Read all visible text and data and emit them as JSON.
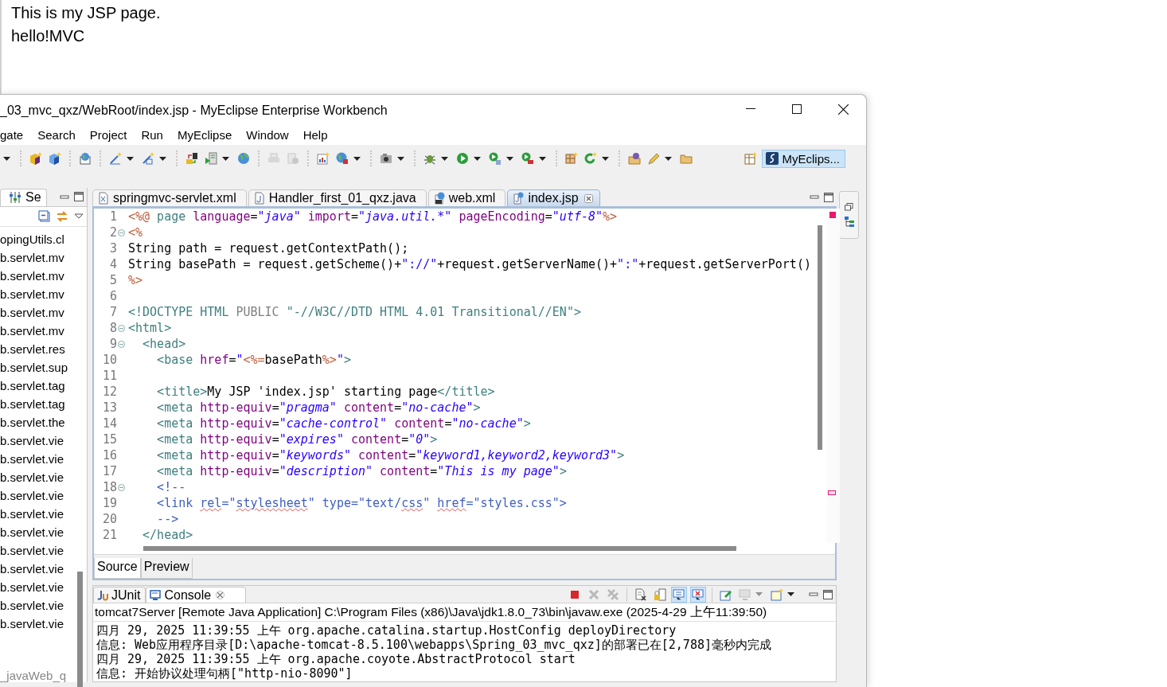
{
  "browser_page": {
    "lines": [
      "This is my JSP page.",
      "hello!MVC"
    ]
  },
  "window": {
    "title": "_03_mvc_qxz/WebRoot/index.jsp - MyEclipse Enterprise Workbench"
  },
  "menu": [
    "gate",
    "Search",
    "Project",
    "Run",
    "MyEclipse",
    "Window",
    "Help"
  ],
  "toolbar": {
    "groups": [
      [
        {
          "kind": "none",
          "dropdown": true,
          "disabled": false
        }
      ],
      [
        {
          "kind": "cube",
          "dropdown": false,
          "disabled": false
        },
        {
          "kind": "cube-blue",
          "dropdown": false,
          "disabled": false
        }
      ],
      [
        {
          "kind": "web-page",
          "dropdown": false,
          "disabled": false
        }
      ],
      [
        {
          "kind": "wand",
          "dropdown": true,
          "disabled": false
        },
        {
          "kind": "wand2",
          "dropdown": true,
          "disabled": false
        }
      ],
      [
        {
          "kind": "server",
          "dropdown": false,
          "disabled": false
        },
        {
          "kind": "server-run",
          "dropdown": true,
          "disabled": false
        },
        {
          "kind": "globe",
          "dropdown": false,
          "disabled": false
        }
      ],
      [
        {
          "kind": "printer",
          "dropdown": false,
          "disabled": true
        },
        {
          "kind": "disk",
          "dropdown": false,
          "disabled": true
        }
      ],
      [
        {
          "kind": "chart",
          "dropdown": false,
          "disabled": false
        },
        {
          "kind": "globe-lock",
          "dropdown": true,
          "disabled": false
        }
      ],
      [
        {
          "kind": "camera",
          "dropdown": true,
          "disabled": false
        }
      ],
      [
        {
          "kind": "bug",
          "dropdown": true,
          "disabled": false
        },
        {
          "kind": "play",
          "dropdown": true,
          "disabled": false
        },
        {
          "kind": "run-list",
          "dropdown": true,
          "disabled": false
        },
        {
          "kind": "run-tool",
          "dropdown": true,
          "disabled": false
        }
      ],
      [
        {
          "kind": "grid",
          "dropdown": false,
          "disabled": false
        },
        {
          "kind": "refresh",
          "dropdown": true,
          "disabled": false
        }
      ],
      [
        {
          "kind": "folder-globe",
          "dropdown": false,
          "disabled": false
        },
        {
          "kind": "pen",
          "dropdown": true,
          "disabled": false
        },
        {
          "kind": "folder",
          "dropdown": false,
          "disabled": false
        }
      ]
    ],
    "perspective": {
      "label": "MyEclips...",
      "selected": true
    }
  },
  "explorer": {
    "tab": "Se",
    "items": [
      "opingUtils.cl",
      "b.servlet.mv",
      "b.servlet.mv",
      "b.servlet.mv",
      "b.servlet.mv",
      "b.servlet.mv",
      "b.servlet.res",
      "b.servlet.sup",
      "b.servlet.tag",
      "b.servlet.tag",
      "b.servlet.the",
      "b.servlet.vie",
      "b.servlet.vie",
      "b.servlet.vie",
      "b.servlet.vie",
      "b.servlet.vie",
      "b.servlet.vie",
      "b.servlet.vie",
      "b.servlet.vie",
      "b.servlet.vie",
      "b.servlet.vie",
      "b.servlet.vie"
    ],
    "footer": "_javaWeb_q"
  },
  "editor": {
    "tabs": [
      {
        "label": "springmvc-servlet.xml",
        "selected": false
      },
      {
        "label": "Handler_first_01_qxz.java",
        "selected": false
      },
      {
        "label": "web.xml",
        "selected": false
      },
      {
        "label": "index.jsp",
        "selected": true
      }
    ],
    "lines": [
      {
        "number": "1",
        "fold": false,
        "tokens": [
          {
            "t": "<%@",
            "kind": "jsp"
          },
          {
            "t": " page",
            "kind": "tag"
          },
          {
            "t": " language",
            "kind": "attr"
          },
          {
            "t": "=",
            "kind": "text"
          },
          {
            "t": "\"java\"",
            "kind": "value"
          },
          {
            "t": " import",
            "kind": "attr"
          },
          {
            "t": "=",
            "kind": "text"
          },
          {
            "t": "\"java.util.*\"",
            "kind": "value"
          },
          {
            "t": " pageEncoding",
            "kind": "attr"
          },
          {
            "t": "=",
            "kind": "text"
          },
          {
            "t": "\"utf-8\"",
            "kind": "value"
          },
          {
            "t": "%>",
            "kind": "jsp"
          }
        ]
      },
      {
        "number": "2",
        "fold": true,
        "tokens": [
          {
            "t": "<%",
            "kind": "jsp"
          }
        ]
      },
      {
        "number": "3",
        "fold": false,
        "tokens": [
          {
            "t": "String path = request.getContextPath();",
            "kind": "text"
          }
        ]
      },
      {
        "number": "4",
        "fold": false,
        "tokens": [
          {
            "t": "String basePath = request.getScheme()+",
            "kind": "text"
          },
          {
            "t": "\"://\"",
            "kind": "str"
          },
          {
            "t": "+request.getServerName()+",
            "kind": "text"
          },
          {
            "t": "\":\"",
            "kind": "str"
          },
          {
            "t": "+request.getServerPort()",
            "kind": "text"
          }
        ]
      },
      {
        "number": "5",
        "fold": false,
        "tokens": [
          {
            "t": "%>",
            "kind": "jsp"
          }
        ]
      },
      {
        "number": "6",
        "fold": false
      },
      {
        "number": "7",
        "fold": false,
        "tokens": [
          {
            "t": "<!DOCTYPE HTML ",
            "kind": "tag"
          },
          {
            "t": "PUBLIC ",
            "kind": "grey"
          },
          {
            "t": "\"-//W3C//DTD HTML 4.01 Transitional//EN\">",
            "kind": "tag"
          }
        ]
      },
      {
        "number": "8",
        "fold": true,
        "tokens": [
          {
            "t": "<html>",
            "kind": "tag"
          }
        ]
      },
      {
        "number": "9",
        "fold": true,
        "tokens": [
          {
            "t": "  <head>",
            "kind": "tag"
          }
        ]
      },
      {
        "number": "10",
        "fold": false,
        "tokens": [
          {
            "t": "    <base",
            "kind": "tag"
          },
          {
            "t": " href",
            "kind": "attr"
          },
          {
            "t": "=",
            "kind": "text"
          },
          {
            "t": "\"",
            "kind": "str"
          },
          {
            "t": "<%=",
            "kind": "jsp"
          },
          {
            "t": "basePath",
            "kind": "text"
          },
          {
            "t": "%>",
            "kind": "jsp"
          },
          {
            "t": "\"",
            "kind": "str"
          },
          {
            "t": ">",
            "kind": "tag"
          }
        ]
      },
      {
        "number": "11",
        "fold": false
      },
      {
        "number": "12",
        "fold": false,
        "tokens": [
          {
            "t": "    <title>",
            "kind": "tag"
          },
          {
            "t": "My JSP 'index.jsp' starting page",
            "kind": "text"
          },
          {
            "t": "</title>",
            "kind": "tag"
          }
        ]
      },
      {
        "number": "13",
        "fold": false,
        "tokens": [
          {
            "t": "    <meta",
            "kind": "tag"
          },
          {
            "t": " http-equiv",
            "kind": "attr"
          },
          {
            "t": "=",
            "kind": "text"
          },
          {
            "t": "\"pragma\"",
            "kind": "value"
          },
          {
            "t": " content",
            "kind": "attr"
          },
          {
            "t": "=",
            "kind": "text"
          },
          {
            "t": "\"no-cache\"",
            "kind": "value"
          },
          {
            "t": ">",
            "kind": "tag"
          }
        ]
      },
      {
        "number": "14",
        "fold": false,
        "tokens": [
          {
            "t": "    <meta",
            "kind": "tag"
          },
          {
            "t": " http-equiv",
            "kind": "attr"
          },
          {
            "t": "=",
            "kind": "text"
          },
          {
            "t": "\"cache-control\"",
            "kind": "value"
          },
          {
            "t": " content",
            "kind": "attr"
          },
          {
            "t": "=",
            "kind": "text"
          },
          {
            "t": "\"no-cache\"",
            "kind": "value"
          },
          {
            "t": ">",
            "kind": "tag"
          }
        ]
      },
      {
        "number": "15",
        "fold": false,
        "tokens": [
          {
            "t": "    <meta",
            "kind": "tag"
          },
          {
            "t": " http-equiv",
            "kind": "attr"
          },
          {
            "t": "=",
            "kind": "text"
          },
          {
            "t": "\"expires\"",
            "kind": "value"
          },
          {
            "t": " content",
            "kind": "attr"
          },
          {
            "t": "=",
            "kind": "text"
          },
          {
            "t": "\"0\"",
            "kind": "value"
          },
          {
            "t": ">",
            "kind": "tag"
          }
        ]
      },
      {
        "number": "16",
        "fold": false,
        "tokens": [
          {
            "t": "    <meta",
            "kind": "tag"
          },
          {
            "t": " http-equiv",
            "kind": "attr"
          },
          {
            "t": "=",
            "kind": "text"
          },
          {
            "t": "\"keywords\"",
            "kind": "value"
          },
          {
            "t": " content",
            "kind": "attr"
          },
          {
            "t": "=",
            "kind": "text"
          },
          {
            "t": "\"keyword1,keyword2,keyword3\"",
            "kind": "value"
          },
          {
            "t": ">",
            "kind": "tag"
          }
        ]
      },
      {
        "number": "17",
        "fold": false,
        "tokens": [
          {
            "t": "    <meta",
            "kind": "tag"
          },
          {
            "t": " http-equiv",
            "kind": "attr"
          },
          {
            "t": "=",
            "kind": "text"
          },
          {
            "t": "\"description\"",
            "kind": "value"
          },
          {
            "t": " content",
            "kind": "attr"
          },
          {
            "t": "=",
            "kind": "text"
          },
          {
            "t": "\"This is my page\"",
            "kind": "value"
          },
          {
            "t": ">",
            "kind": "tag"
          }
        ]
      },
      {
        "number": "18",
        "fold": true,
        "tokens": [
          {
            "t": "    <!--",
            "kind": "comment"
          }
        ]
      },
      {
        "number": "19",
        "fold": false,
        "tokens": [
          {
            "t": "    <link ",
            "kind": "comment"
          },
          {
            "t": "rel",
            "kind": "spell"
          },
          {
            "t": "=\"",
            "kind": "comment"
          },
          {
            "t": "stylesheet",
            "kind": "spell"
          },
          {
            "t": "\" type=\"text/",
            "kind": "comment"
          },
          {
            "t": "css",
            "kind": "spell"
          },
          {
            "t": "\" ",
            "kind": "comment"
          },
          {
            "t": "href",
            "kind": "spell"
          },
          {
            "t": "=\"styles.css\">",
            "kind": "comment"
          }
        ]
      },
      {
        "number": "20",
        "fold": false,
        "tokens": [
          {
            "t": "    -->",
            "kind": "comment"
          }
        ]
      },
      {
        "number": "21",
        "fold": false,
        "tokens": [
          {
            "t": "  </head>",
            "kind": "tag"
          }
        ]
      }
    ],
    "bottom_tabs": [
      {
        "label": "Source",
        "selected": true
      },
      {
        "label": "Preview",
        "selected": false
      }
    ]
  },
  "console": {
    "tabs": [
      {
        "label": "JUnit",
        "selected": false
      },
      {
        "label": "Console",
        "selected": true
      }
    ],
    "toolbar": [
      [
        {
          "kind": "stop",
          "dropdown": false,
          "disabled": false,
          "on": false
        },
        {
          "kind": "remove",
          "dropdown": false,
          "disabled": true,
          "on": false
        },
        {
          "kind": "remove-all",
          "dropdown": false,
          "disabled": true,
          "on": false
        }
      ],
      [
        {
          "kind": "clear",
          "dropdown": false,
          "disabled": false,
          "on": false
        },
        {
          "kind": "lock",
          "dropdown": false,
          "disabled": false,
          "on": false
        },
        {
          "kind": "pin",
          "dropdown": false,
          "disabled": false,
          "on": true
        },
        {
          "kind": "monitor-x",
          "dropdown": false,
          "disabled": false,
          "on": true
        }
      ],
      [
        {
          "kind": "edit-console",
          "dropdown": false,
          "disabled": false,
          "on": false
        },
        {
          "kind": "monitor",
          "dropdown": true,
          "disabled": true,
          "on": false
        },
        {
          "kind": "new-console",
          "dropdown": true,
          "disabled": false,
          "on": false
        }
      ]
    ],
    "header": "tomcat7Server [Remote Java Application] C:\\Program Files (x86)\\Java\\jdk1.8.0_73\\bin\\javaw.exe (2025-4-29 上午11:39:50)",
    "lines": [
      "四月 29, 2025 11:39:55 上午 org.apache.catalina.startup.HostConfig deployDirectory",
      "信息: Web应用程序目录[D:\\apache-tomcat-8.5.100\\webapps\\Spring_03_mvc_qxz]的部署已在[2,788]毫秒内完成",
      "四月 29, 2025 11:39:55 上午 org.apache.coyote.AbstractProtocol start",
      "信息: 开始协议处理句柄[\"http-nio-8090\"]"
    ]
  }
}
